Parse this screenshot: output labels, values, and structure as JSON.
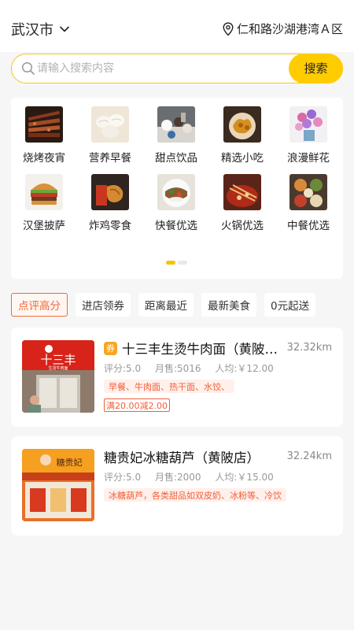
{
  "header": {
    "city": "武汉市",
    "location": "仁和路沙湖港湾Ａ区"
  },
  "search": {
    "placeholder": "请输入搜索内容",
    "button_label": "搜索"
  },
  "categories": [
    {
      "label": "烧烤夜宵",
      "icon": "bbq-image"
    },
    {
      "label": "营养早餐",
      "icon": "breakfast-image"
    },
    {
      "label": "甜点饮品",
      "icon": "dessert-image"
    },
    {
      "label": "精选小吃",
      "icon": "snack-image"
    },
    {
      "label": "浪漫鲜花",
      "icon": "flower-image"
    },
    {
      "label": "汉堡披萨",
      "icon": "burger-image"
    },
    {
      "label": "炸鸡零食",
      "icon": "fried-chicken-image"
    },
    {
      "label": "快餐优选",
      "icon": "fastfood-image"
    },
    {
      "label": "火锅优选",
      "icon": "hotpot-image"
    },
    {
      "label": "中餐优选",
      "icon": "chinese-food-image"
    }
  ],
  "pager": {
    "pages": 2,
    "current": 1
  },
  "filters": [
    {
      "label": "点评高分",
      "active": true
    },
    {
      "label": "进店领券",
      "active": false
    },
    {
      "label": "距离最近",
      "active": false
    },
    {
      "label": "最新美食",
      "active": false
    },
    {
      "label": "0元起送",
      "active": false
    }
  ],
  "shops": [
    {
      "badge": "券",
      "name": "十三丰生烫牛肉面（黄陂店）",
      "distance": "32.32km",
      "rating": "评分:5.0",
      "sales": "月售:5016",
      "avg": "人均:￥12.00",
      "tags": "早餐、牛肉面、热干面、水饺、",
      "promo": "满20.00减2.00",
      "sign_text": "十三丰",
      "sign_sub": "生烫牛肉面"
    },
    {
      "badge": "",
      "name": "糖贵妃冰糖葫芦（黄陂店）",
      "distance": "32.24km",
      "rating": "评分:5.0",
      "sales": "月售:2000",
      "avg": "人均:￥15.00",
      "tags": "冰糖葫芦，各类甜品如双皮奶、冰粉等、冷饮",
      "promo": "",
      "sign_text": "糖贵妃"
    }
  ],
  "colors": {
    "accent": "#ffcc00",
    "tag_red": "#f0603a",
    "badge": "#f5a623"
  }
}
